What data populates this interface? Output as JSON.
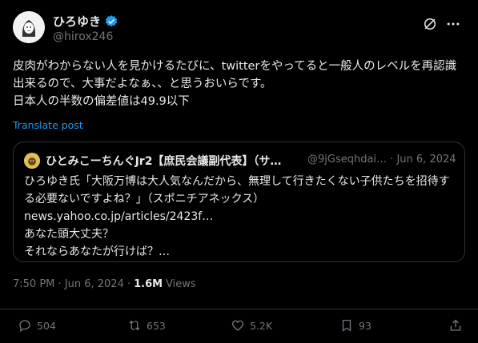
{
  "author": {
    "name": "ひろゆき",
    "handle": "@hirox246"
  },
  "tweet": {
    "text": "皮肉がわからない人を見かけるたびに、twitterをやってると一般人のレベルを再認識出来るので、大事だよなぁ、、と思うおいらです。\n日本人の半数の偏差値は49.9以下",
    "translate_label": "Translate post"
  },
  "quote": {
    "name": "ひとみこーちんぐJr2【庶民会議副代表】（サ…",
    "handle": "@9jGseqhdai…",
    "date": "· Jun 6, 2024",
    "text_main": "ひろゆき氏「大阪万博は大人気なんだから、無理して行きたくない子供たちを招待する必要ないですよね？」（スポニチアネックス）",
    "link": "news.yahoo.co.jp/articles/2423f…",
    "text_tail": "あなた頭大丈夫？\nそれならあなたが行けば？…"
  },
  "meta": {
    "time": "7:50 PM · Jun 6, 2024 ·",
    "views_count": "1.6M",
    "views_label": "Views"
  },
  "actions": {
    "replies": "504",
    "reposts": "653",
    "likes": "5.2K",
    "bookmarks": "93"
  },
  "colors": {
    "background": "#000000",
    "text": "#e7e9ea",
    "muted": "#71767b",
    "accent": "#1d9bf0",
    "verified": "#1d9bf0"
  }
}
